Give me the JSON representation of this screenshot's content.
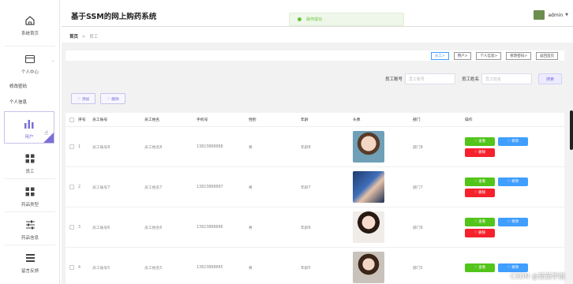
{
  "header": {
    "title": "基于SSM的网上购药系统",
    "toast": "操作成功",
    "user": "admin",
    "caret": "▼"
  },
  "sidebar": {
    "home": "系统首页",
    "personal": "个人中心",
    "sub_items": [
      "修改密码",
      "个人信息"
    ],
    "items": [
      "用户",
      "员工",
      "药品类型",
      "药品信息",
      "留言反馈"
    ]
  },
  "breadcrumb": {
    "home": "首页",
    "sep": ">",
    "current": "员工"
  },
  "toolbar": {
    "buttons": [
      "员工>",
      "用户>",
      "个人信息>",
      "修改密码>",
      "返回首页"
    ]
  },
  "search": {
    "label_no": "员工账号",
    "placeholder_no": "员工账号",
    "label_name": "员工姓名",
    "placeholder_name": "员工姓名",
    "button": "搜索"
  },
  "actions": {
    "add": "♡ 添加",
    "delete": "♡ 删除"
  },
  "table": {
    "headers": [
      "序号",
      "员工账号",
      "员工姓名",
      "手机号",
      "性别",
      "年龄",
      "头像",
      "部门",
      "操作"
    ],
    "rows": [
      {
        "idx": "1",
        "no": "员工账号8",
        "name": "员工姓名8",
        "phone": "13823888888",
        "gender": "男",
        "age": "年龄8",
        "dept": "部门8"
      },
      {
        "idx": "2",
        "no": "员工账号7",
        "name": "员工姓名7",
        "phone": "13823888887",
        "gender": "男",
        "age": "年龄7",
        "dept": "部门7"
      },
      {
        "idx": "3",
        "no": "员工账号6",
        "name": "员工姓名6",
        "phone": "13823888886",
        "gender": "男",
        "age": "年龄6",
        "dept": "部门6"
      },
      {
        "idx": "4",
        "no": "员工账号5",
        "name": "员工姓名5",
        "phone": "13823888885",
        "gender": "男",
        "age": "年龄5",
        "dept": "部门5"
      }
    ],
    "op_view": "♡ 查看",
    "op_edit": "♡ 修改",
    "op_delete": "♡ 删除"
  },
  "watermark": "CSDN @茹茹学姐",
  "colors": {
    "accent": "#7a6fd6",
    "success": "#52c41a",
    "primary": "#409eff",
    "danger": "#f5222d"
  }
}
